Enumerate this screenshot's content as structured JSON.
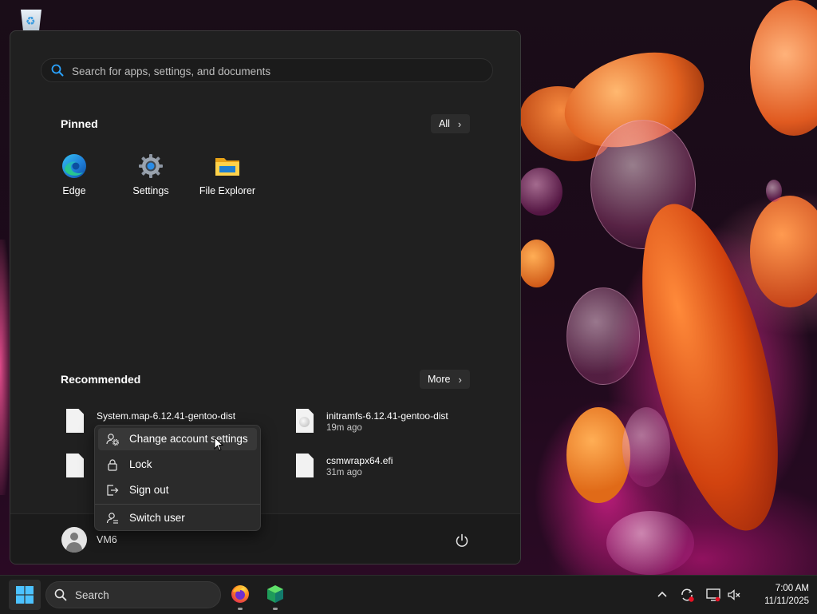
{
  "start_menu": {
    "search_placeholder": "Search for apps, settings, and documents",
    "pinned": {
      "title": "Pinned",
      "all_button": "All",
      "apps": [
        {
          "label": "Edge",
          "icon": "edge-icon"
        },
        {
          "label": "Settings",
          "icon": "settings-gear-icon"
        },
        {
          "label": "File Explorer",
          "icon": "folder-icon"
        }
      ]
    },
    "recommended": {
      "title": "Recommended",
      "more_button": "More",
      "items": [
        {
          "name": "System.map-6.12.41-gentoo-dist",
          "time": ""
        },
        {
          "name": "initramfs-6.12.41-gentoo-dist",
          "time": "19m ago"
        },
        {
          "name": "csmwrapx64.efi",
          "time": "31m ago"
        }
      ]
    },
    "user": {
      "name": "VM6"
    }
  },
  "account_menu": {
    "items": [
      {
        "label": "Change account settings",
        "icon": "account-settings-icon"
      },
      {
        "label": "Lock",
        "icon": "lock-icon"
      },
      {
        "label": "Sign out",
        "icon": "sign-out-icon"
      },
      {
        "label": "Switch user",
        "icon": "switch-user-icon"
      }
    ]
  },
  "taskbar": {
    "search_label": "Search",
    "clock": {
      "time": "7:00 AM",
      "date": "11/11/2025"
    }
  },
  "colors": {
    "menu_bg": "#202020",
    "context_bg": "#2b2b2b",
    "taskbar_bg": "#1c1c1c",
    "accent_blue": "#2aa3ff"
  }
}
